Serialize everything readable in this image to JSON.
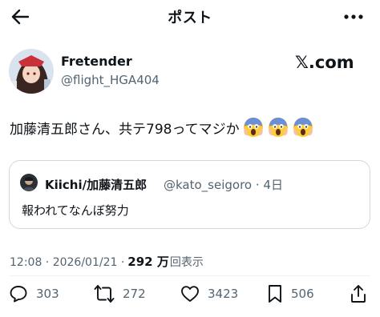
{
  "header": {
    "title": "ポスト"
  },
  "post": {
    "display_name": "Fretender",
    "handle": "@flight_HGA404",
    "source_label": "𝕏.com",
    "text": "加藤清五郎さん、共テ798ってマジか",
    "emoji": [
      "screaming-face-emoji",
      "screaming-face-emoji",
      "screaming-face-emoji"
    ]
  },
  "quote": {
    "display_name": "Kiichi/加藤清五郎",
    "handle_meta": "@kato_seigoro · 4日",
    "text": "報われてなんぼ努力"
  },
  "meta": {
    "time_date": "12:08 · 2026/01/21 ·",
    "views_count": "292 万",
    "views_label": "回表示"
  },
  "actions": {
    "reply_count": "303",
    "repost_count": "272",
    "like_count": "3423",
    "bookmark_count": "506"
  },
  "colors": {
    "text": "#0f1419",
    "secondary": "#536471",
    "border": "#cfd9de"
  }
}
